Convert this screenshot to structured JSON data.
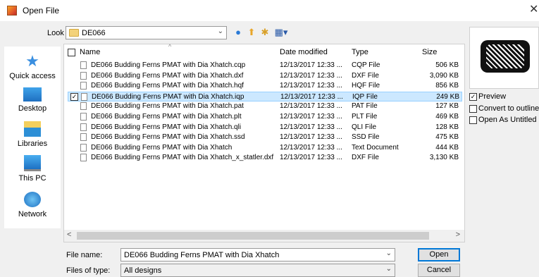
{
  "window": {
    "title": "Open File",
    "close_icon": "close-icon"
  },
  "look_in": {
    "label": "Look in:",
    "value": "DE066"
  },
  "places": [
    {
      "label": "Quick access",
      "icon": "star-icon"
    },
    {
      "label": "Desktop",
      "icon": "desktop-icon"
    },
    {
      "label": "Libraries",
      "icon": "libraries-icon"
    },
    {
      "label": "This PC",
      "icon": "computer-icon"
    },
    {
      "label": "Network",
      "icon": "network-icon"
    }
  ],
  "columns": {
    "name": "Name",
    "date": "Date modified",
    "type": "Type",
    "size": "Size"
  },
  "files": [
    {
      "name": "DE066 Budding Ferns PMAT with Dia Xhatch.cqp",
      "date": "12/13/2017 12:33 ...",
      "type": "CQP File",
      "size": "506 KB"
    },
    {
      "name": "DE066 Budding Ferns PMAT with Dia Xhatch.dxf",
      "date": "12/13/2017 12:33 ...",
      "type": "DXF File",
      "size": "3,090 KB"
    },
    {
      "name": "DE066 Budding Ferns PMAT with Dia Xhatch.hqf",
      "date": "12/13/2017 12:33 ...",
      "type": "HQF File",
      "size": "856 KB"
    },
    {
      "name": "DE066 Budding Ferns PMAT with Dia Xhatch.iqp",
      "date": "12/13/2017 12:33 ...",
      "type": "IQP File",
      "size": "249 KB"
    },
    {
      "name": "DE066 Budding Ferns PMAT with Dia Xhatch.pat",
      "date": "12/13/2017 12:33 ...",
      "type": "PAT File",
      "size": "127 KB"
    },
    {
      "name": "DE066 Budding Ferns PMAT with Dia Xhatch.plt",
      "date": "12/13/2017 12:33 ...",
      "type": "PLT File",
      "size": "469 KB"
    },
    {
      "name": "DE066 Budding Ferns PMAT with Dia Xhatch.qli",
      "date": "12/13/2017 12:33 ...",
      "type": "QLI File",
      "size": "128 KB"
    },
    {
      "name": "DE066 Budding Ferns PMAT with Dia Xhatch.ssd",
      "date": "12/13/2017 12:33 ...",
      "type": "SSD File",
      "size": "475 KB"
    },
    {
      "name": "DE066 Budding Ferns PMAT with Dia Xhatch",
      "date": "12/13/2017 12:33 ...",
      "type": "Text Document",
      "size": "444 KB"
    },
    {
      "name": "DE066 Budding Ferns PMAT with Dia Xhatch_x_statler.dxf",
      "date": "12/13/2017 12:33 ...",
      "type": "DXF File",
      "size": "3,130 KB"
    }
  ],
  "options": {
    "preview": "Preview",
    "convert": "Convert to outlines",
    "untitled": "Open As Untitled"
  },
  "file_name": {
    "label": "File name:",
    "value": "DE066 Budding Ferns PMAT with Dia Xhatch"
  },
  "file_type": {
    "label": "Files of type:",
    "value": "All designs"
  },
  "buttons": {
    "open": "Open",
    "cancel": "Cancel"
  },
  "scroll": {
    "left": "<",
    "right": ">"
  }
}
